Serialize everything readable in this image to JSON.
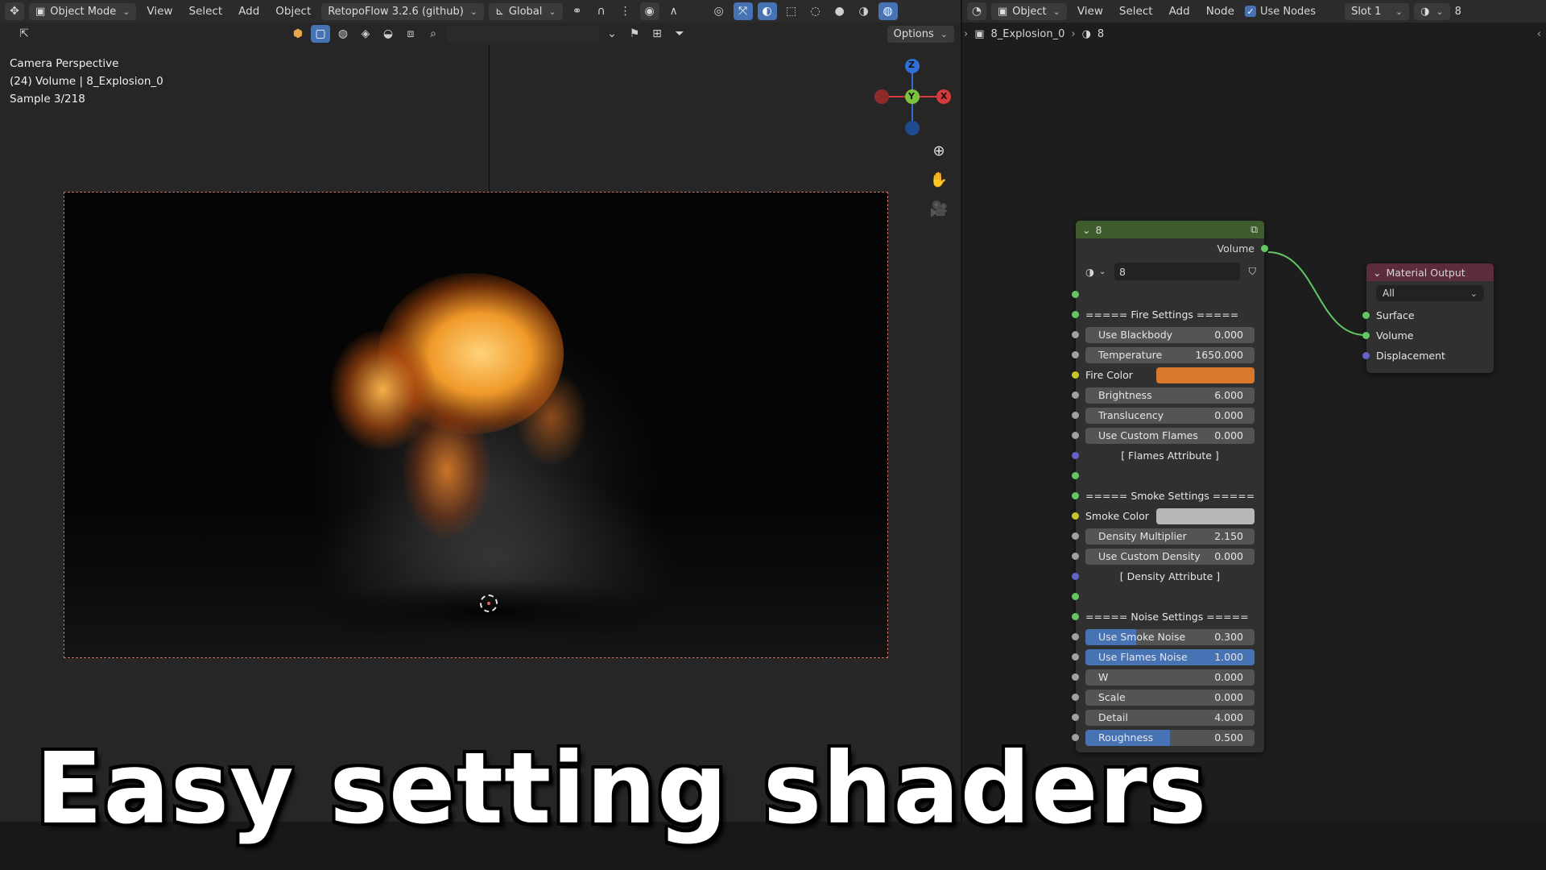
{
  "viewport": {
    "header": {
      "mode": "Object Mode",
      "menus": [
        "View",
        "Select",
        "Add",
        "Object"
      ],
      "addon": "RetopoFlow 3.2.6 (github)",
      "orientation": "Global"
    },
    "options_label": "Options",
    "overlay": {
      "line1": "Camera Perspective",
      "line2": "(24) Volume | 8_Explosion_0",
      "line3": "Sample 3/218"
    },
    "gizmo": {
      "z": "Z",
      "y": "Y",
      "x": "X"
    }
  },
  "node_editor": {
    "header": {
      "object_type": "Object",
      "menus": [
        "View",
        "Select",
        "Add",
        "Node"
      ],
      "use_nodes": "Use Nodes",
      "slot": "Slot 1",
      "material": "8"
    },
    "breadcrumb": {
      "object": "8_Explosion_0",
      "material": "8"
    },
    "group_node": {
      "title": "8",
      "output": "Volume",
      "datablock": "8",
      "fire_header": "=====   Fire  Settings   =====",
      "use_blackbody": {
        "label": "Use Blackbody",
        "value": "0.000"
      },
      "temperature": {
        "label": "Temperature",
        "value": "1650.000"
      },
      "fire_color": {
        "label": "Fire Color",
        "color": "#d9772a"
      },
      "brightness": {
        "label": "Brightness",
        "value": "6.000"
      },
      "translucency": {
        "label": "Translucency",
        "value": "0.000"
      },
      "use_custom_flames": {
        "label": "Use Custom Flames",
        "value": "0.000"
      },
      "flames_attribute": "[ Flames Attribute ]",
      "smoke_header": "===== Smoke Settings =====",
      "smoke_color": {
        "label": "Smoke Color",
        "color": "#b7b7b7"
      },
      "density_multiplier": {
        "label": "Density Multiplier",
        "value": "2.150"
      },
      "use_custom_density": {
        "label": "Use Custom Density",
        "value": "0.000"
      },
      "density_attribute": "[ Density Attribute ]",
      "noise_header": "=====  Noise Settings  =====",
      "use_smoke_noise": {
        "label": "Use Smoke Noise",
        "value": "0.300",
        "fraction": 0.3
      },
      "use_flames_noise": {
        "label": "Use Flames Noise",
        "value": "1.000",
        "fraction": 1.0
      },
      "w": {
        "label": "W",
        "value": "0.000"
      },
      "scale": {
        "label": "Scale",
        "value": "0.000"
      },
      "detail": {
        "label": "Detail",
        "value": "4.000"
      },
      "roughness": {
        "label": "Roughness",
        "value": "0.500",
        "fraction": 0.5
      }
    },
    "output_node": {
      "title": "Material Output",
      "target": "All",
      "inputs": [
        "Surface",
        "Volume",
        "Displacement"
      ]
    }
  },
  "caption": "Easy setting shaders",
  "colors": {
    "accent": "#4772b3",
    "fire_color": "#d9772a",
    "smoke_color": "#b7b7b7",
    "group_header": "#3f5c2c",
    "output_header": "#5c2c3a"
  }
}
